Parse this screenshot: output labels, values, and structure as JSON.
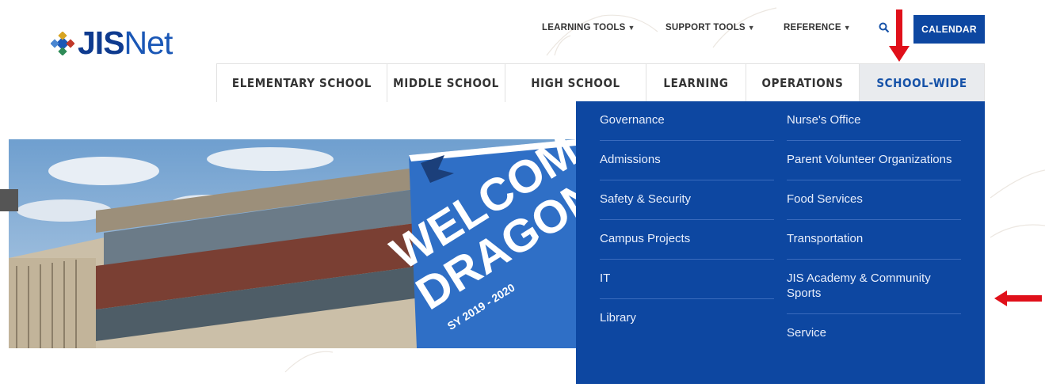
{
  "logo": {
    "bold_text": "JIS",
    "light_text": "Net"
  },
  "utility_nav": {
    "items": [
      {
        "label": "LEARNING TOOLS",
        "icon": "caret-down-icon"
      },
      {
        "label": "SUPPORT TOOLS",
        "icon": "caret-down-icon"
      },
      {
        "label": "REFERENCE",
        "icon": "caret-down-icon"
      }
    ],
    "search_icon": "search-icon",
    "calendar_label": "CALENDAR"
  },
  "main_nav": {
    "items": [
      {
        "label": "ELEMENTARY SCHOOL"
      },
      {
        "label": "MIDDLE SCHOOL"
      },
      {
        "label": "HIGH SCHOOL"
      },
      {
        "label": "LEARNING"
      },
      {
        "label": "OPERATIONS"
      },
      {
        "label": "SCHOOL-WIDE",
        "active": true
      }
    ]
  },
  "hero": {
    "banner_line1": "WELCOM",
    "banner_line2": "DRAGONS",
    "banner_year": "SY 2019 - 2020"
  },
  "dropdown": {
    "left_column": [
      "Governance",
      "Admissions",
      "Safety & Security",
      "Campus Projects",
      "IT",
      "Library"
    ],
    "right_column": [
      "Nurse's Office",
      "Parent Volunteer Organizations",
      "Food Services",
      "Transportation",
      "JIS Academy & Community Sports",
      "Service"
    ]
  },
  "colors": {
    "brand_blue": "#0d47a1",
    "active_nav_bg": "#e9ebee",
    "annotation_red": "#e0101a"
  }
}
